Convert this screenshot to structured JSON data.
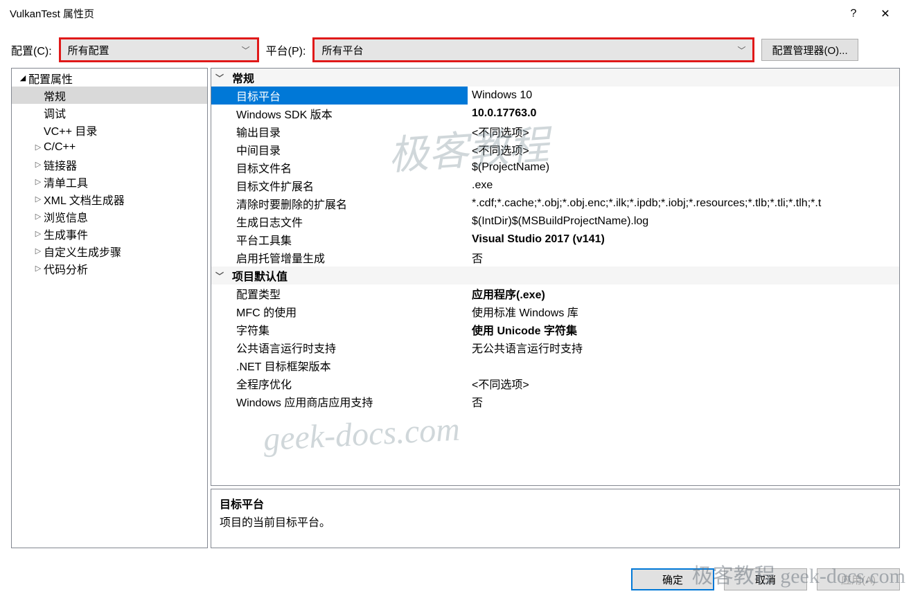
{
  "title": "VulkanTest 属性页",
  "help_icon": "?",
  "close_icon": "✕",
  "top": {
    "config_label": "配置(C):",
    "config_value": "所有配置",
    "platform_label": "平台(P):",
    "platform_value": "所有平台",
    "manager_btn": "配置管理器(O)..."
  },
  "tree": {
    "root": "配置属性",
    "items": [
      {
        "label": "常规",
        "selected": true,
        "leaf": true
      },
      {
        "label": "调试",
        "leaf": true
      },
      {
        "label": "VC++ 目录",
        "leaf": true
      },
      {
        "label": "C/C++",
        "leaf": false
      },
      {
        "label": "链接器",
        "leaf": false
      },
      {
        "label": "清单工具",
        "leaf": false
      },
      {
        "label": "XML 文档生成器",
        "leaf": false
      },
      {
        "label": "浏览信息",
        "leaf": false
      },
      {
        "label": "生成事件",
        "leaf": false
      },
      {
        "label": "自定义生成步骤",
        "leaf": false
      },
      {
        "label": "代码分析",
        "leaf": false
      }
    ]
  },
  "sections": [
    {
      "name": "常规",
      "rows": [
        {
          "k": "目标平台",
          "v": "Windows 10",
          "selected": true
        },
        {
          "k": "Windows SDK 版本",
          "v": "10.0.17763.0",
          "bold": true
        },
        {
          "k": "输出目录",
          "v": "<不同选项>"
        },
        {
          "k": "中间目录",
          "v": "<不同选项>"
        },
        {
          "k": "目标文件名",
          "v": "$(ProjectName)"
        },
        {
          "k": "目标文件扩展名",
          "v": ".exe"
        },
        {
          "k": "清除时要删除的扩展名",
          "v": "*.cdf;*.cache;*.obj;*.obj.enc;*.ilk;*.ipdb;*.iobj;*.resources;*.tlb;*.tli;*.tlh;*.t"
        },
        {
          "k": "生成日志文件",
          "v": "$(IntDir)$(MSBuildProjectName).log"
        },
        {
          "k": "平台工具集",
          "v": "Visual Studio 2017 (v141)",
          "bold": true
        },
        {
          "k": "启用托管增量生成",
          "v": "否"
        }
      ]
    },
    {
      "name": "项目默认值",
      "rows": [
        {
          "k": "配置类型",
          "v": "应用程序(.exe)",
          "bold": true
        },
        {
          "k": "MFC 的使用",
          "v": "使用标准 Windows 库"
        },
        {
          "k": "字符集",
          "v": "使用 Unicode 字符集",
          "bold": true
        },
        {
          "k": "公共语言运行时支持",
          "v": "无公共语言运行时支持"
        },
        {
          "k": ".NET 目标框架版本",
          "v": ""
        },
        {
          "k": "全程序优化",
          "v": "<不同选项>"
        },
        {
          "k": "Windows 应用商店应用支持",
          "v": "否"
        }
      ]
    }
  ],
  "help": {
    "title": "目标平台",
    "desc": "项目的当前目标平台。"
  },
  "footer": {
    "ok": "确定",
    "cancel": "取消",
    "apply": "应用(A)"
  },
  "watermarks": {
    "wm1": "极客教程",
    "wm2": "geek-docs.com",
    "wm3": "极客教程 geek-docs.com"
  }
}
